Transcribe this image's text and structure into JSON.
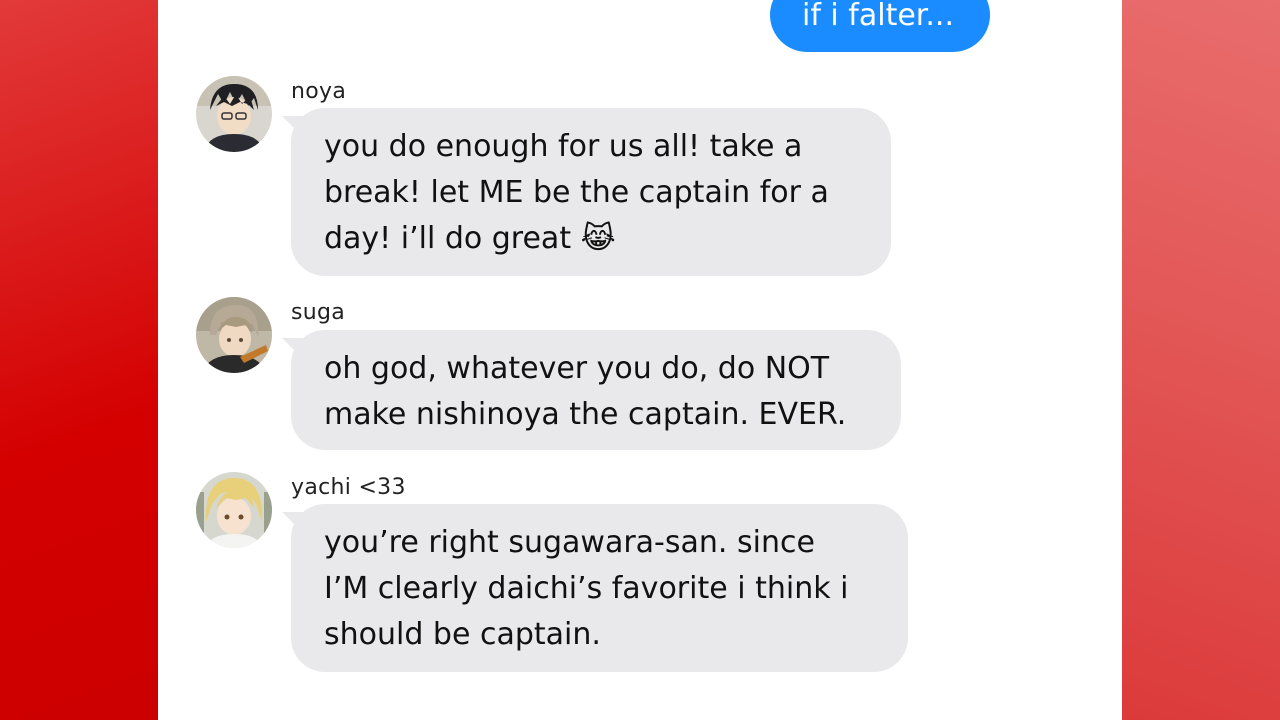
{
  "outgoing": {
    "text": "if i falter..."
  },
  "messages": [
    {
      "sender": "noya",
      "lines": [
        "you do enough for us all! take a",
        "break! let ME be the captain for a",
        "day! i’ll do great 😹"
      ]
    },
    {
      "sender": "suga",
      "lines": [
        "oh god, whatever you do, do NOT",
        "make nishinoya the captain. EVER."
      ]
    },
    {
      "sender": "yachi <33",
      "lines": [
        "you’re right sugawara-san. since",
        "I’M clearly daichi’s favorite i think i",
        "should be captain."
      ]
    }
  ],
  "colors": {
    "outgoing_bubble": "#1a8cff",
    "incoming_bubble": "#e9e9eb",
    "frame_red": "#d40000"
  },
  "icons": [
    "avatar-noya",
    "avatar-suga",
    "avatar-yachi",
    "cat-tears-of-joy-emoji"
  ]
}
